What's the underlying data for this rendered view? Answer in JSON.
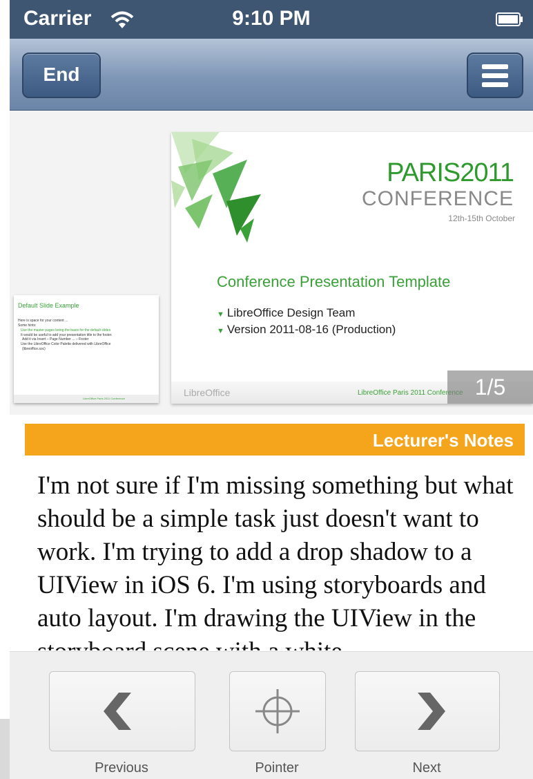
{
  "status_bar": {
    "carrier": "Carrier",
    "time": "9:10 PM"
  },
  "nav": {
    "end_label": "End"
  },
  "main_slide": {
    "paris_text": "PARIS2011",
    "conference_text": "CONFERENCE",
    "date": "12th-15th October",
    "title": "Conference Presentation Template",
    "bullets": [
      "LibreOffice Design Team",
      "Version 2011-08-16 (Production)"
    ],
    "footer_logo": "LibreOffice",
    "footer_text": "LibreOffice Paris 2011 Conference",
    "counter": "1/5"
  },
  "thumb_slide": {
    "title": "Default Slide Example",
    "lines": [
      "Here is space for your content ...",
      "Some hints:",
      "Use the master pages being the basis for the default slides",
      "It would be useful to add your presentation title to the footer.",
      "Add it via Insert – Page Number ... – Footer",
      "Use the LibreOffice Color Palette delivered with LibreOffice",
      "(libreoffice.soc)"
    ],
    "footer_text": "LibreOffice Paris 2011 Conference"
  },
  "notes": {
    "header": "Lecturer's Notes",
    "body": "I'm not sure if I'm missing something but what should be a simple task just doesn't want to work. I'm trying to add a drop shadow to a UIView in iOS 6. I'm using storyboards and auto layout. I'm drawing the UIView in the storyboard scene with a white"
  },
  "toolbar": {
    "previous_label": "Previous",
    "pointer_label": "Pointer",
    "next_label": "Next"
  },
  "colors": {
    "accent": "#f4a51c",
    "navbar": "#6b85a8",
    "slide_green": "#3aa138"
  }
}
